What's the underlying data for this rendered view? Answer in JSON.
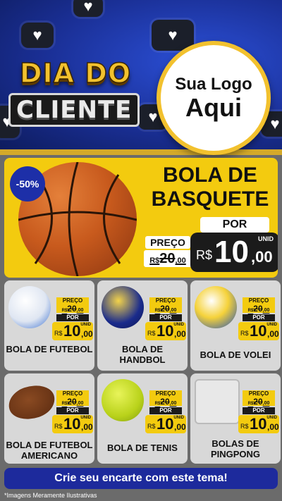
{
  "header": {
    "title_line1": "DIA DO",
    "title_line2": "CLIENTE",
    "logo_line1": "Sua Logo",
    "logo_line2": "Aqui"
  },
  "featured": {
    "discount": "-50%",
    "name": "BOLA DE BASQUETE",
    "por_label": "POR",
    "preco_label": "PREÇO",
    "old_price_currency": "R$",
    "old_price": "20",
    "old_price_dec": ",00",
    "price_currency": "R$",
    "price_int": "10",
    "price_dec": ",00",
    "unit": "UNID"
  },
  "products": [
    {
      "name": "BOLA DE FUTEBOL"
    },
    {
      "name": "BOLA DE HANDBOL"
    },
    {
      "name": "BOLA DE VOLEI"
    },
    {
      "name": "BOLA DE FUTEBOL AMERICANO"
    },
    {
      "name": "BOLA DE TENIS"
    },
    {
      "name": "BOLAS DE PINGPONG"
    }
  ],
  "tag": {
    "preco_label": "PREÇO",
    "old_price_currency": "R$",
    "old_price": "20",
    "old_price_dec": ",00",
    "por_label": "POR",
    "price_currency": "R$",
    "price_int": "10",
    "price_dec": ",00",
    "unit": "UNID"
  },
  "cta": "Crie seu encarte com este tema!",
  "footnote": "*Imagens Meramente Ilustrativas",
  "colors": {
    "blue": "#1d2a9c",
    "yellow": "#f3cb0f",
    "gold": "#d4a92a",
    "grey": "#6b6b6b"
  }
}
